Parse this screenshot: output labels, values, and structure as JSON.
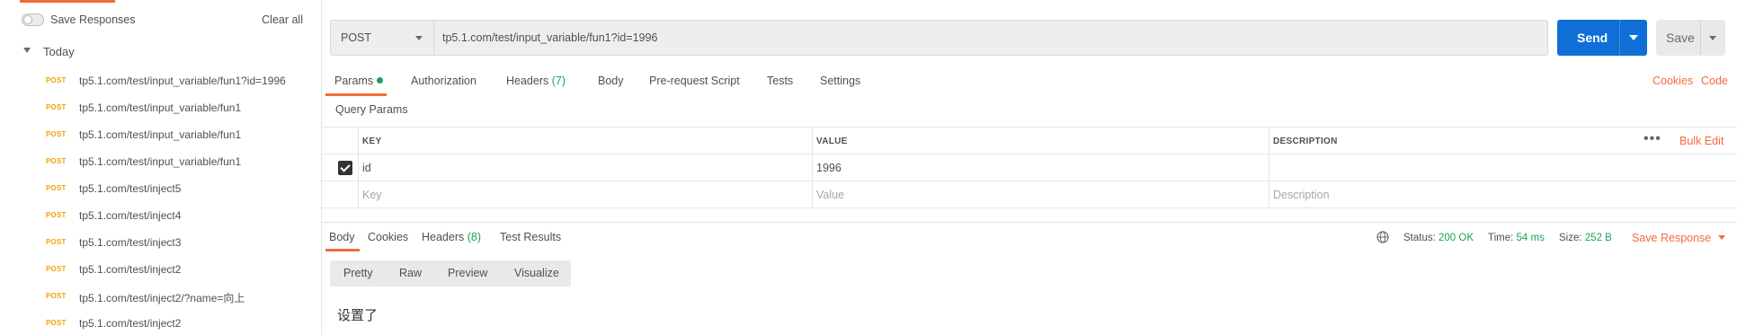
{
  "sidebar": {
    "save_responses_label": "Save Responses",
    "clear_all_label": "Clear all",
    "group_label": "Today",
    "history": [
      {
        "method": "POST",
        "url": "tp5.1.com/test/input_variable/fun1?id=1996"
      },
      {
        "method": "POST",
        "url": "tp5.1.com/test/input_variable/fun1"
      },
      {
        "method": "POST",
        "url": "tp5.1.com/test/input_variable/fun1"
      },
      {
        "method": "POST",
        "url": "tp5.1.com/test/input_variable/fun1"
      },
      {
        "method": "POST",
        "url": "tp5.1.com/test/inject5"
      },
      {
        "method": "POST",
        "url": "tp5.1.com/test/inject4"
      },
      {
        "method": "POST",
        "url": "tp5.1.com/test/inject3"
      },
      {
        "method": "POST",
        "url": "tp5.1.com/test/inject2"
      },
      {
        "method": "POST",
        "url": "tp5.1.com/test/inject2/?name=向上"
      },
      {
        "method": "POST",
        "url": "tp5.1.com/test/inject2"
      }
    ]
  },
  "request": {
    "method": "POST",
    "url": "tp5.1.com/test/input_variable/fun1?id=1996",
    "send_label": "Send",
    "save_label": "Save"
  },
  "request_tabs": {
    "params": "Params",
    "authorization": "Authorization",
    "headers": "Headers",
    "headers_count": "(7)",
    "body": "Body",
    "pre_request": "Pre-request Script",
    "tests": "Tests",
    "settings": "Settings",
    "cookies": "Cookies",
    "code": "Code"
  },
  "query_params": {
    "title": "Query Params",
    "columns": {
      "key": "KEY",
      "value": "VALUE",
      "description": "DESCRIPTION"
    },
    "bulk_edit": "Bulk Edit",
    "rows": [
      {
        "checked": true,
        "key": "id",
        "value": "1996",
        "description": ""
      }
    ],
    "placeholders": {
      "key": "Key",
      "value": "Value",
      "description": "Description"
    }
  },
  "response_tabs": {
    "body": "Body",
    "cookies": "Cookies",
    "headers": "Headers",
    "headers_count": "(8)",
    "test_results": "Test Results"
  },
  "response_status": {
    "status_label": "Status:",
    "status_value": "200 OK",
    "time_label": "Time:",
    "time_value": "54 ms",
    "size_label": "Size:",
    "size_value": "252 B",
    "save_response": "Save Response"
  },
  "response_view": {
    "modes": [
      "Pretty",
      "Raw",
      "Preview",
      "Visualize"
    ],
    "active": "Preview",
    "body_text": "设置了"
  },
  "colors": {
    "accent": "#f26b3a",
    "send_blue": "#0f6fd6",
    "post_method": "#f0a400",
    "status_green": "#1aa35a"
  }
}
